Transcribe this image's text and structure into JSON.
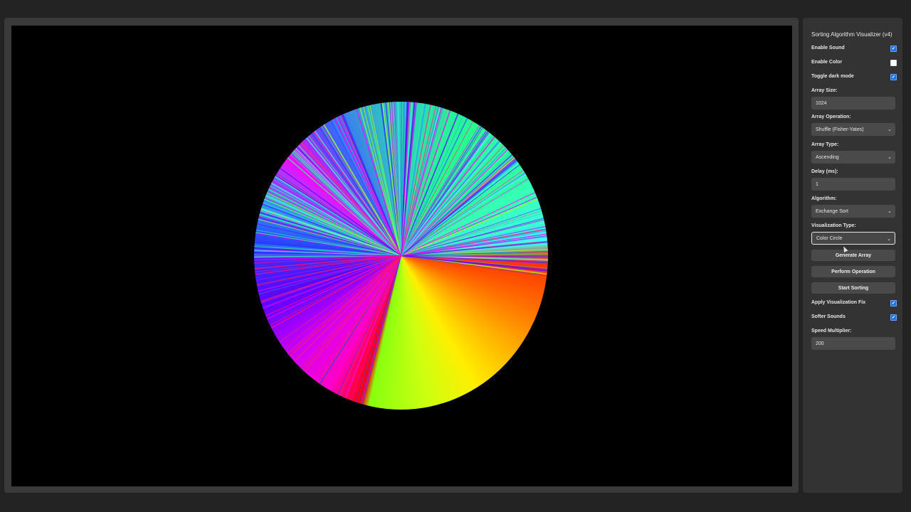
{
  "title": "Sorting Algorithm Visualizer (v4)",
  "enable_sound": {
    "label": "Enable Sound",
    "checked": true
  },
  "enable_color": {
    "label": "Enable Color",
    "checked": false
  },
  "dark_mode": {
    "label": "Toggle dark mode",
    "checked": true
  },
  "array_size": {
    "label": "Array Size:",
    "value": "1024"
  },
  "array_operation": {
    "label": "Array Operation:",
    "value": "Shuffle (Fisher-Yates)"
  },
  "array_type": {
    "label": "Array Type:",
    "value": "Ascending"
  },
  "delay": {
    "label": "Delay (ms):",
    "value": "1"
  },
  "algorithm": {
    "label": "Algorithm:",
    "value": "Exchange Sort"
  },
  "visualization_type": {
    "label": "Visualization Type:",
    "value": "Color Circle"
  },
  "buttons": {
    "generate": "Generate Array",
    "perform": "Perform Operation",
    "start": "Start Sorting"
  },
  "viz_fix": {
    "label": "Apply Visualization Fix",
    "checked": true
  },
  "softer_sounds": {
    "label": "Softer Sounds",
    "checked": true
  },
  "speed_multiplier": {
    "label": "Speed Multiplier:",
    "value": "200"
  },
  "colors": {
    "panel": "#333333",
    "accent": "#1f72e8",
    "canvas": "#000000"
  },
  "icons": {
    "check": "checkmark-icon",
    "caret": "chevron-down-icon"
  }
}
